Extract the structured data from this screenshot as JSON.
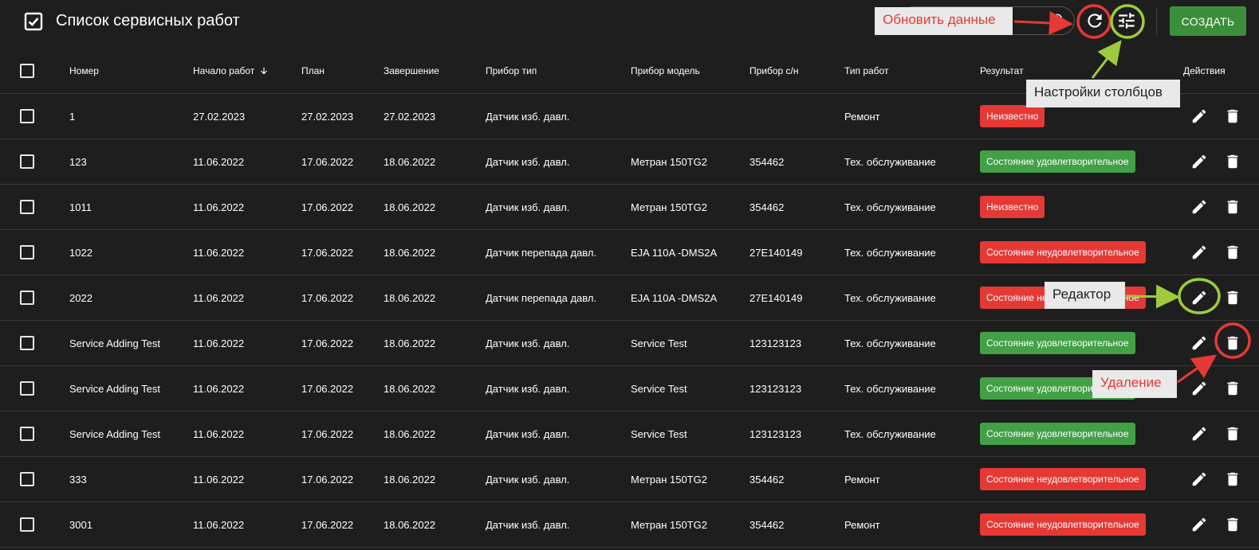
{
  "header": {
    "title": "Список сервисных работ",
    "create_label": "СОЗДАТЬ"
  },
  "columns": [
    "Номер",
    "Начало работ",
    "План",
    "Завершение",
    "Прибор тип",
    "Прибор модель",
    "Прибор с/н",
    "Тип работ",
    "Результат",
    "Действия"
  ],
  "rows": [
    {
      "num": "1",
      "start": "27.02.2023",
      "plan": "27.02.2023",
      "end": "27.02.2023",
      "device_type": "Датчик изб. давл.",
      "device_model": "",
      "serial": "",
      "work_type": "Ремонт",
      "result": "Неизвестно",
      "result_color": "#e53935"
    },
    {
      "num": "123",
      "start": "11.06.2022",
      "plan": "17.06.2022",
      "end": "18.06.2022",
      "device_type": "Датчик изб. давл.",
      "device_model": "Метран 150TG2",
      "serial": "354462",
      "work_type": "Тех. обслуживание",
      "result": "Состояние удовлетворительное",
      "result_color": "#43a047"
    },
    {
      "num": "1011",
      "start": "11.06.2022",
      "plan": "17.06.2022",
      "end": "18.06.2022",
      "device_type": "Датчик изб. давл.",
      "device_model": "Метран 150TG2",
      "serial": "354462",
      "work_type": "Тех. обслуживание",
      "result": "Неизвестно",
      "result_color": "#e53935"
    },
    {
      "num": "1022",
      "start": "11.06.2022",
      "plan": "17.06.2022",
      "end": "18.06.2022",
      "device_type": "Датчик перепада давл.",
      "device_model": "EJA 110A -DMS2A",
      "serial": "27E140149",
      "work_type": "Тех. обслуживание",
      "result": "Состояние неудовлетворительное",
      "result_color": "#e53935"
    },
    {
      "num": "2022",
      "start": "11.06.2022",
      "plan": "17.06.2022",
      "end": "18.06.2022",
      "device_type": "Датчик перепада давл.",
      "device_model": "EJA 110A -DMS2A",
      "serial": "27E140149",
      "work_type": "Тех. обслуживание",
      "result": "Состояние неудовлетворительное",
      "result_color": "#e53935"
    },
    {
      "num": "Service Adding Test",
      "start": "11.06.2022",
      "plan": "17.06.2022",
      "end": "18.06.2022",
      "device_type": "Датчик изб. давл.",
      "device_model": "Service Test",
      "serial": "123123123",
      "work_type": "Тех. обслуживание",
      "result": "Состояние удовлетворительное",
      "result_color": "#43a047"
    },
    {
      "num": "Service Adding Test",
      "start": "11.06.2022",
      "plan": "17.06.2022",
      "end": "18.06.2022",
      "device_type": "Датчик изб. давл.",
      "device_model": "Service Test",
      "serial": "123123123",
      "work_type": "Тех. обслуживание",
      "result": "Состояние удовлетворительное",
      "result_color": "#43a047"
    },
    {
      "num": "Service Adding Test",
      "start": "11.06.2022",
      "plan": "17.06.2022",
      "end": "18.06.2022",
      "device_type": "Датчик изб. давл.",
      "device_model": "Service Test",
      "serial": "123123123",
      "work_type": "Тех. обслуживание",
      "result": "Состояние удовлетворительное",
      "result_color": "#43a047"
    },
    {
      "num": "333",
      "start": "11.06.2022",
      "plan": "17.06.2022",
      "end": "18.06.2022",
      "device_type": "Датчик изб. давл.",
      "device_model": "Метран 150TG2",
      "serial": "354462",
      "work_type": "Ремонт",
      "result": "Состояние неудовлетворительное",
      "result_color": "#e53935"
    },
    {
      "num": "3001",
      "start": "11.06.2022",
      "plan": "17.06.2022",
      "end": "18.06.2022",
      "device_type": "Датчик изб. давл.",
      "device_model": "Метран 150TG2",
      "serial": "354462",
      "work_type": "Ремонт",
      "result": "Состояние неудовлетворительное",
      "result_color": "#e53935"
    }
  ],
  "annotations": {
    "refresh": "Обновить данные",
    "columns_settings": "Настройки столбцов",
    "editor": "Редактор",
    "delete": "Удаление",
    "red_color": "#e53935",
    "green_color": "#9ccc3c"
  },
  "icons": [
    "checkbox-checked-icon",
    "search-icon",
    "refresh-icon",
    "tune-icon",
    "arrow-down-icon",
    "pencil-icon",
    "trash-icon"
  ],
  "colors": {
    "background": "#1e1e1e",
    "create_button": "#3c8f3a",
    "badge_red": "#e53935",
    "badge_green": "#43a047"
  }
}
